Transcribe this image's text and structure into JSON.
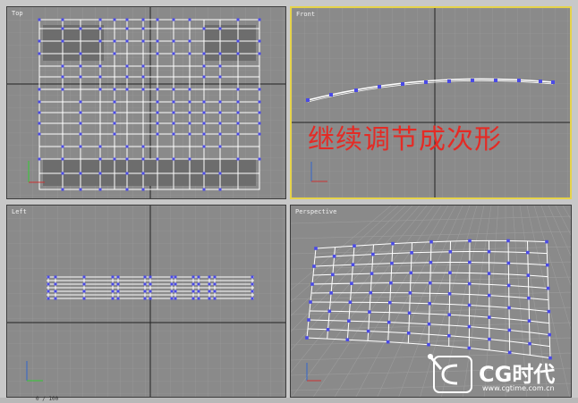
{
  "viewports": {
    "top": {
      "label": "Top"
    },
    "front": {
      "label": "Front"
    },
    "left": {
      "label": "Left"
    },
    "perspective": {
      "label": "Perspective"
    }
  },
  "overlay_text": "继续调节成次形",
  "logo": {
    "text": "CG时代",
    "url": "www.cgtime.com.cn"
  },
  "status_bar": {
    "text": "0 / 100"
  },
  "colors": {
    "viewport_bg": "#8a8a8a",
    "active_border": "#e6d34a",
    "vertex": "#4a4ae6",
    "overlay": "#e42b25"
  }
}
